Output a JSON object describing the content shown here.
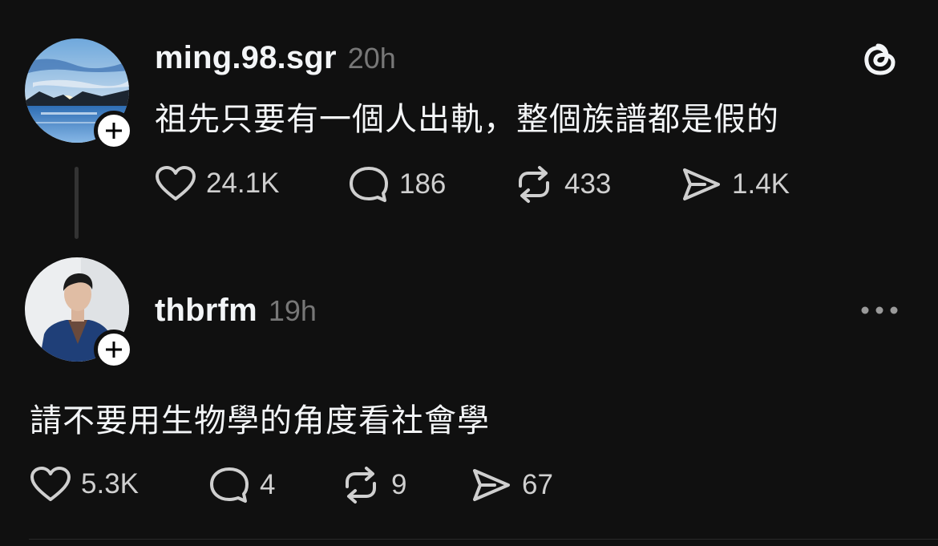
{
  "posts": [
    {
      "username": "ming.98.sgr",
      "time": "20h",
      "text": "祖先只要有一個人出軌，整個族譜都是假的",
      "likes": "24.1K",
      "replies": "186",
      "reposts": "433",
      "shares": "1.4K",
      "icons": [
        "heart-icon",
        "comment-icon",
        "repost-icon",
        "share-icon",
        "threads-logo-icon"
      ]
    },
    {
      "username": "thbrfm",
      "time": "19h",
      "text": "請不要用生物學的角度看社會學",
      "likes": "5.3K",
      "replies": "4",
      "reposts": "9",
      "shares": "67",
      "icons": [
        "heart-icon",
        "comment-icon",
        "repost-icon",
        "share-icon",
        "more-icon"
      ]
    }
  ],
  "colors": {
    "background": "#101010",
    "text": "#f3f5f7",
    "muted": "#777777"
  }
}
